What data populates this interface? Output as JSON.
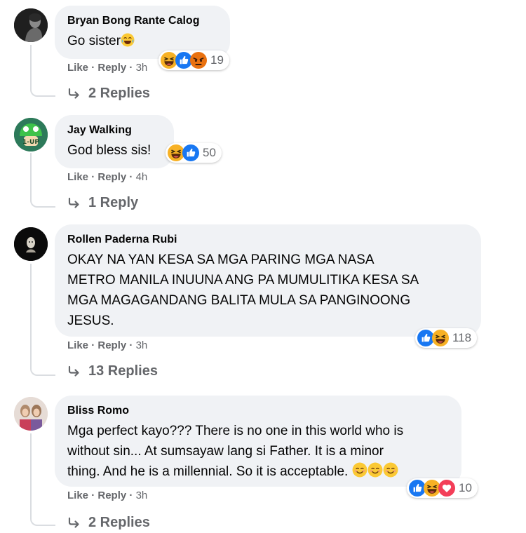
{
  "comments": [
    {
      "author": "Bryan Bong Rante Calog",
      "text": "Go sister",
      "reaction_count": "19",
      "reactions": [
        "haha",
        "like",
        "angry"
      ],
      "actions": {
        "like": "Like",
        "reply": "Reply",
        "time": "3h",
        "sep": "·"
      },
      "replies_label": "2 Replies"
    },
    {
      "author": "Jay Walking",
      "text": "God bless sis!",
      "reaction_count": "50",
      "reactions": [
        "haha",
        "like"
      ],
      "actions": {
        "like": "Like",
        "reply": "Reply",
        "time": "4h",
        "sep": "·"
      },
      "replies_label": "1 Reply"
    },
    {
      "author": "Rollen Paderna Rubi",
      "text_lines": [
        "OKAY NA YAN KESA SA MGA PARING MGA NASA",
        "METRO MANILA INUUNA ANG PA MUMULITIKA KESA SA",
        "MGA MAGAGANDANG BALITA MULA SA PANGINOONG",
        "JESUS."
      ],
      "reaction_count": "118",
      "reactions": [
        "like",
        "haha"
      ],
      "actions": {
        "like": "Like",
        "reply": "Reply",
        "time": "3h",
        "sep": "·"
      },
      "replies_label": "13 Replies"
    },
    {
      "author": "Bliss Romo",
      "text_lines": [
        "Mga perfect kayo??? There is no one in this world who is",
        "without sin... At sumsayaw lang si Father. It is a minor",
        "thing. And he is a millennial. So it is acceptable."
      ],
      "reaction_count": "10",
      "reactions": [
        "like",
        "haha",
        "love"
      ],
      "actions": {
        "like": "Like",
        "reply": "Reply",
        "time": "3h",
        "sep": "·"
      },
      "replies_label": "2 Replies"
    }
  ],
  "colors": {
    "bubble": "#f0f2f5",
    "secondary_text": "#65676b",
    "like_blue": "#1877f2",
    "haha_yellow": "#f7b125",
    "angry_orange": "#e9710f",
    "love_red": "#f33e58"
  }
}
